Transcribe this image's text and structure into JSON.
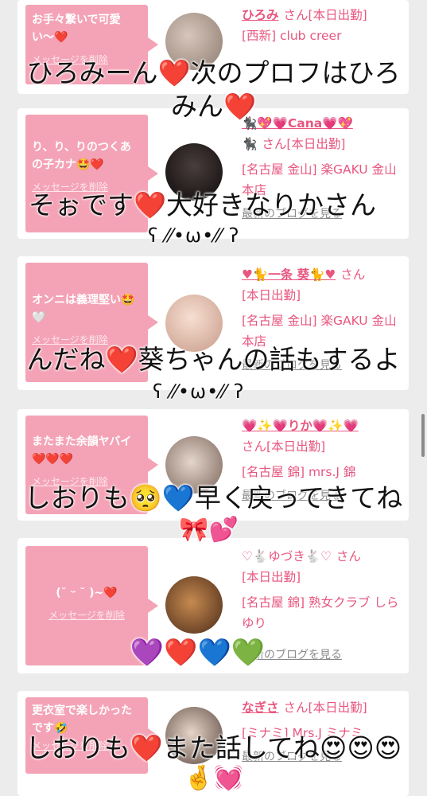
{
  "cards": [
    {
      "message": "お手々繋いで可愛い〜❤️",
      "delete_label": "メッセージを削除",
      "name": "ひろみ",
      "san": "さん",
      "status": "[本日出勤]",
      "shop": "[西新] club creer",
      "blog_link": "",
      "avatar_colors": [
        "#c9b8ad",
        "#8d7b70"
      ]
    },
    {
      "message": "り、り、りのつくあの子カナ🤩❤️",
      "delete_label": "メッセージを削除",
      "name": "🐈‍⬛💖💗Cana💗💖",
      "name_line2": "🐈‍⬛",
      "san": "さん",
      "status": "[本日出勤]",
      "shop": "[名古屋 金山] 楽GAKU 金山本店",
      "blog_link": "最新のブログを見る",
      "avatar_colors": [
        "#3a3030",
        "#0e0a0a"
      ]
    },
    {
      "message": "オンニは義理堅い🤩🤍",
      "delete_label": "メッセージを削除",
      "name": "♥🐈一条 葵🐈♥",
      "san": "さん",
      "status": "[本日出勤]",
      "shop": "[名古屋 金山] 楽GAKU 金山本店",
      "blog_link": "最新のブログを見る",
      "avatar_colors": [
        "#f2d3c4",
        "#c79a88"
      ]
    },
    {
      "message": "またまた余韻ヤバイ❤️❤️❤️",
      "delete_label": "メッセージを削除",
      "name": "💗✨💗りか💗✨💗",
      "san": "さん",
      "status": "[本日出勤]",
      "shop": "[名古屋 錦] mrs.J 錦",
      "blog_link": "最新のブログを見る",
      "avatar_colors": [
        "#d8c8bc",
        "#7a6358"
      ]
    },
    {
      "message": "(˘ ᵕ ˘ )~❤️",
      "delete_label": "メッセージを削除",
      "name": "♡🐇ゆづき🐇♡",
      "san": "さん",
      "status": "[本日出勤]",
      "shop": "[名古屋 錦] 熟女クラブ しらゆり",
      "blog_link": "最新のブログを見る",
      "avatar_colors": [
        "#b7773e",
        "#4a2a18"
      ]
    },
    {
      "message": "更衣室で楽しかったです🤣",
      "delete_label": "メッセージを削除",
      "name": "なぎさ",
      "san": "さん",
      "status": "[本日出勤]",
      "shop": "[ミナミ] Mrs.J ミナミ",
      "blog_link": "最新のブログを見る",
      "avatar_colors": [
        "#d9c6b8",
        "#5a463e"
      ]
    }
  ],
  "overlays": [
    "ひろみーん❤️次のプロフはひろ",
    "みん❤️",
    "そぉです❤️大好きなりかさん",
    "ʕ ⁄⁄•ω•⁄⁄ ʔ",
    "んだね❤️葵ちゃんの話もするよ",
    "ʕ ⁄⁄•ω•⁄⁄ ʔ",
    "しおりも🥺💙早く戻ってきてね",
    "🎀💕",
    "💜❤️💙💚",
    "しおりも❤️また話してね😍😍😍",
    "🤞💓"
  ]
}
